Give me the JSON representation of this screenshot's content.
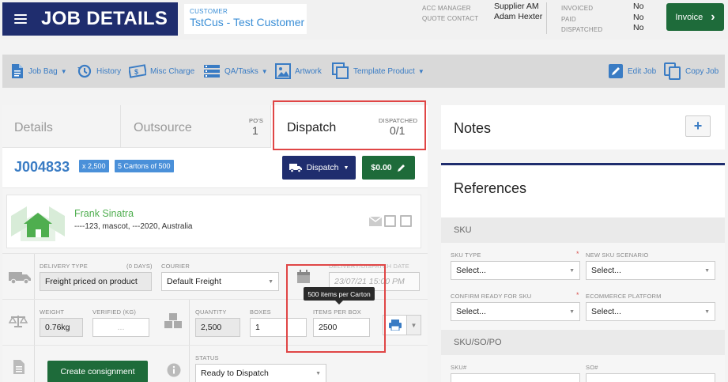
{
  "header": {
    "title": "JOB DETAILS",
    "customer_label": "CUSTOMER",
    "customer_name": "TstCus - Test Customer",
    "acc_manager_label": "ACC MANAGER",
    "acc_manager_value": "Supplier AM",
    "quote_contact_label": "QUOTE CONTACT",
    "quote_contact_value": "Adam Hexter",
    "invoiced_label": "INVOICED",
    "invoiced_value": "No",
    "paid_label": "PAID",
    "paid_value": "No",
    "dispatched_label": "DISPATCHED",
    "dispatched_value": "No",
    "invoice_button": "Invoice"
  },
  "toolbar": {
    "items": [
      {
        "label": "Job Bag",
        "icon": "document-icon",
        "dropdown": true
      },
      {
        "label": "History",
        "icon": "history-icon",
        "dropdown": false
      },
      {
        "label": "Misc Charge",
        "icon": "money-icon",
        "dropdown": false
      },
      {
        "label": "QA/Tasks",
        "icon": "tasks-icon",
        "dropdown": true
      },
      {
        "label": "Artwork",
        "icon": "image-icon",
        "dropdown": false
      },
      {
        "label": "Template Product",
        "icon": "copy-icon",
        "dropdown": true
      },
      {
        "label": "Edit Job",
        "icon": "edit-icon",
        "dropdown": false
      },
      {
        "label": "Copy Job",
        "icon": "copy-job-icon",
        "dropdown": false
      }
    ]
  },
  "tabs": {
    "details": "Details",
    "outsource": "Outsource",
    "pos_label": "PO'S",
    "pos_value": "1",
    "dispatch": "Dispatch",
    "dispatched_label": "DISPATCHED",
    "dispatched_value": "0/1"
  },
  "job": {
    "number": "J004833",
    "quantity_badge": "x 2,500",
    "cartons_badge": "5 Cartons of 500",
    "dispatch_button": "Dispatch",
    "amount_button": "$0.00"
  },
  "contact": {
    "name": "Frank Sinatra",
    "address": "----123, mascot, ---2020, Australia"
  },
  "delivery": {
    "type_label": "DELIVERY TYPE",
    "days_label": "(0 DAYS)",
    "type_value": "Freight priced on product",
    "courier_label": "COURIER",
    "courier_value": "Default Freight",
    "date_label": "DELIVERY/DISPATCH DATE",
    "date_value": "23/07/21 15:00 PM"
  },
  "weights": {
    "weight_label": "WEIGHT",
    "weight_value": "0.76kg",
    "verified_label": "VERIFIED (KG)",
    "verified_placeholder": "...",
    "quantity_label": "QUANTITY",
    "quantity_value": "2,500",
    "boxes_label": "BOXES",
    "boxes_value": "1",
    "items_label": "ITEMS PER BOX",
    "items_value": "2500",
    "tooltip": "500 items per Carton"
  },
  "consignment": {
    "create_button": "Create consignment",
    "status_label": "STATUS",
    "status_value": "Ready to Dispatch"
  },
  "notes": {
    "title": "Notes",
    "add_button": "+"
  },
  "references": {
    "title": "References",
    "sku_section": "SKU",
    "sku_type_label": "SKU TYPE",
    "sku_type_value": "Select...",
    "new_sku_label": "NEW SKU SCENARIO",
    "new_sku_value": "Select...",
    "confirm_label": "CONFIRM READY FOR SKU",
    "confirm_value": "Select...",
    "platform_label": "ECOMMERCE PLATFORM",
    "platform_value": "Select...",
    "required_mark": "*",
    "skusopo_section": "SKU/SO/PO",
    "sku_no_label": "SKU#",
    "so_no_label": "SO#"
  }
}
